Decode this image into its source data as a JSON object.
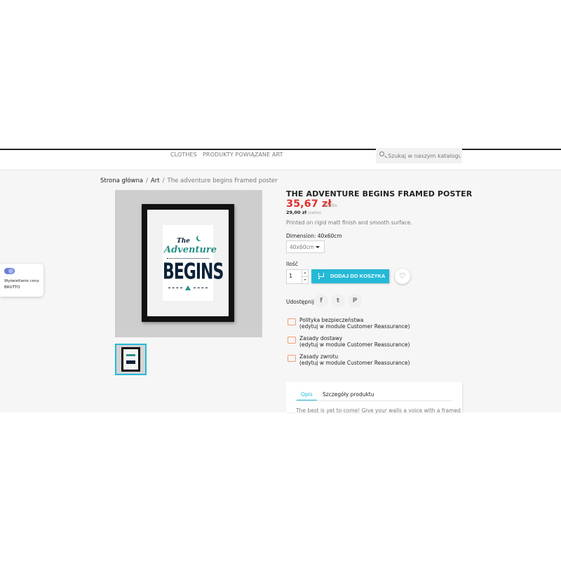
{
  "nav": {
    "items": [
      "CLOTHES",
      "PRODUKTY POWIĄZANE",
      "ART"
    ],
    "search_placeholder": "Szukaj w naszym katalogu"
  },
  "breadcrumb": {
    "home": "Strona główna",
    "category": "Art",
    "current": "The adventure begins Framed poster",
    "separator": "/"
  },
  "product": {
    "title": "THE ADVENTURE BEGINS FRAMED POSTER",
    "price": "35,67 zł",
    "tax_label": "Brutto",
    "net_price": "29,00 zł",
    "net_label": "(netto)",
    "short_description": "Printed on rigid matt finish and smooth surface.",
    "dimension_label": "Dimension: 40x60cm",
    "dimension_selected": "40x60cm",
    "quantity_label": "Ilość",
    "quantity_value": "1",
    "add_to_cart": "DODAJ DO KOSZYKA",
    "share_label": "Udostępnij",
    "poster": {
      "the": "The",
      "adventure": "Adventure",
      "begins": "BEGINS"
    }
  },
  "reassurance": [
    {
      "title": "Polityka bezpieczeństwa",
      "subtitle": "(edytuj w module Customer Reassurance)"
    },
    {
      "title": "Zasady dostawy",
      "subtitle": "(edytuj w module Customer Reassurance)"
    },
    {
      "title": "Zasady zwrotu",
      "subtitle": "(edytuj w module Customer Reassurance)"
    }
  ],
  "tabs": {
    "items": [
      "Opis",
      "Szczegóły produktu"
    ],
    "description_start": "The best is yet to come! Give your walls a voice with a framed"
  },
  "price_widget": {
    "label": "Wyświetlanie ceny:",
    "value": "BRUTTO"
  },
  "social": {
    "facebook": "f",
    "twitter": "t",
    "pinterest": "P"
  },
  "colors": {
    "accent": "#24b9d7",
    "price": "#e0302e",
    "poster_teal": "#2a8f85",
    "poster_navy": "#0c2137"
  }
}
